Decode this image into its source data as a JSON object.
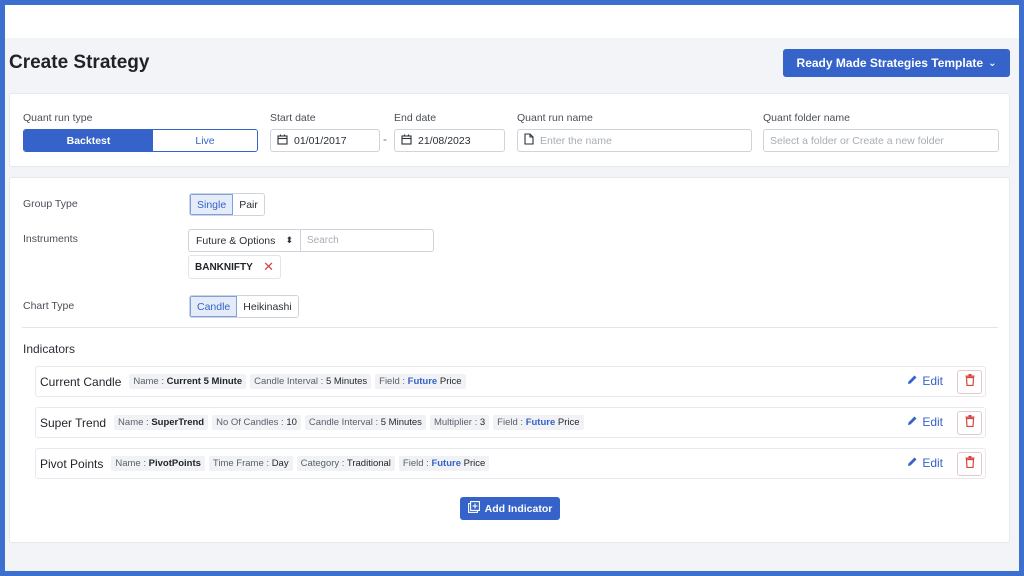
{
  "header": {
    "title": "Create Strategy",
    "template_button": "Ready Made Strategies Template"
  },
  "run_config": {
    "run_type_label": "Quant run type",
    "run_type_options": [
      "Backtest",
      "Live"
    ],
    "run_type_selected": "Backtest",
    "start_date_label": "Start date",
    "start_date": "01/01/2017",
    "date_separator": "-",
    "end_date_label": "End date",
    "end_date": "21/08/2023",
    "run_name_label": "Quant run name",
    "run_name_placeholder": "Enter the name",
    "folder_label": "Quant folder name",
    "folder_placeholder": "Select a folder or Create a new folder"
  },
  "group_type": {
    "label": "Group Type",
    "options": [
      "Single",
      "Pair"
    ],
    "selected": "Single"
  },
  "instruments": {
    "label": "Instruments",
    "segment": "Future & Options",
    "search_placeholder": "Search",
    "selected": [
      "BANKNIFTY"
    ]
  },
  "chart_type": {
    "label": "Chart Type",
    "options": [
      "Candle",
      "Heikinashi"
    ],
    "selected": "Candle"
  },
  "indicators": {
    "title": "Indicators",
    "edit_label": "Edit",
    "add_label": "Add Indicator",
    "items": [
      {
        "name": "Current Candle",
        "tags": [
          {
            "key": "Name",
            "value": "Current 5 Minute"
          },
          {
            "key": "Candle Interval",
            "value": "5 Minutes"
          },
          {
            "key": "Field",
            "value_blue": "Future",
            "value": "Price"
          }
        ]
      },
      {
        "name": "Super Trend",
        "tags": [
          {
            "key": "Name",
            "value": "SuperTrend"
          },
          {
            "key": "No Of Candles",
            "value": "10"
          },
          {
            "key": "Candle Interval",
            "value": "5 Minutes"
          },
          {
            "key": "Multiplier",
            "value": "3"
          },
          {
            "key": "Field",
            "value_blue": "Future",
            "value": "Price"
          }
        ]
      },
      {
        "name": "Pivot Points",
        "tags": [
          {
            "key": "Name",
            "value": "PivotPoints"
          },
          {
            "key": "Time Frame",
            "value": "Day"
          },
          {
            "key": "Category",
            "value": "Traditional"
          },
          {
            "key": "Field",
            "value_blue": "Future",
            "value": "Price"
          }
        ]
      }
    ]
  },
  "colors": {
    "primary": "#3563c9",
    "danger": "#d6453d",
    "background": "#f3f4f7"
  }
}
